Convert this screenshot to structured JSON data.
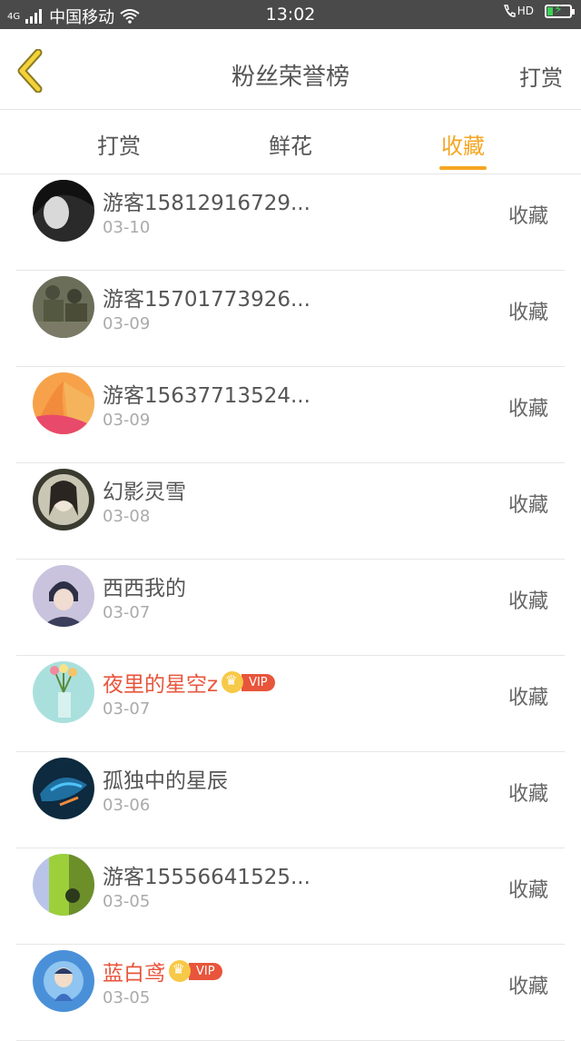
{
  "status_bar": {
    "network": "4G",
    "carrier": "中国移动",
    "time": "13:02",
    "hd": "HD"
  },
  "nav": {
    "title": "粉丝荣誉榜",
    "action_label": "打赏"
  },
  "tabs": [
    {
      "label": "打赏",
      "active": false
    },
    {
      "label": "鲜花",
      "active": false
    },
    {
      "label": "收藏",
      "active": true
    }
  ],
  "colors": {
    "accent": "#f5a623",
    "vip_name": "#e8553b",
    "status_bar_bg": "#4a4a4a"
  },
  "rows": [
    {
      "name": "游客15812916729...",
      "date": "03-10",
      "action": "收藏",
      "vip": false
    },
    {
      "name": "游客15701773926...",
      "date": "03-09",
      "action": "收藏",
      "vip": false
    },
    {
      "name": "游客15637713524...",
      "date": "03-09",
      "action": "收藏",
      "vip": false
    },
    {
      "name": "幻影灵雪",
      "date": "03-08",
      "action": "收藏",
      "vip": false
    },
    {
      "name": "西西我的",
      "date": "03-07",
      "action": "收藏",
      "vip": false
    },
    {
      "name": "夜里的星空z",
      "date": "03-07",
      "action": "收藏",
      "vip": true,
      "vip_label": "VIP"
    },
    {
      "name": "孤独中的星辰",
      "date": "03-06",
      "action": "收藏",
      "vip": false
    },
    {
      "name": "游客15556641525...",
      "date": "03-05",
      "action": "收藏",
      "vip": false
    },
    {
      "name": "蓝白鸢",
      "date": "03-05",
      "action": "收藏",
      "vip": true,
      "vip_label": "VIP"
    }
  ]
}
